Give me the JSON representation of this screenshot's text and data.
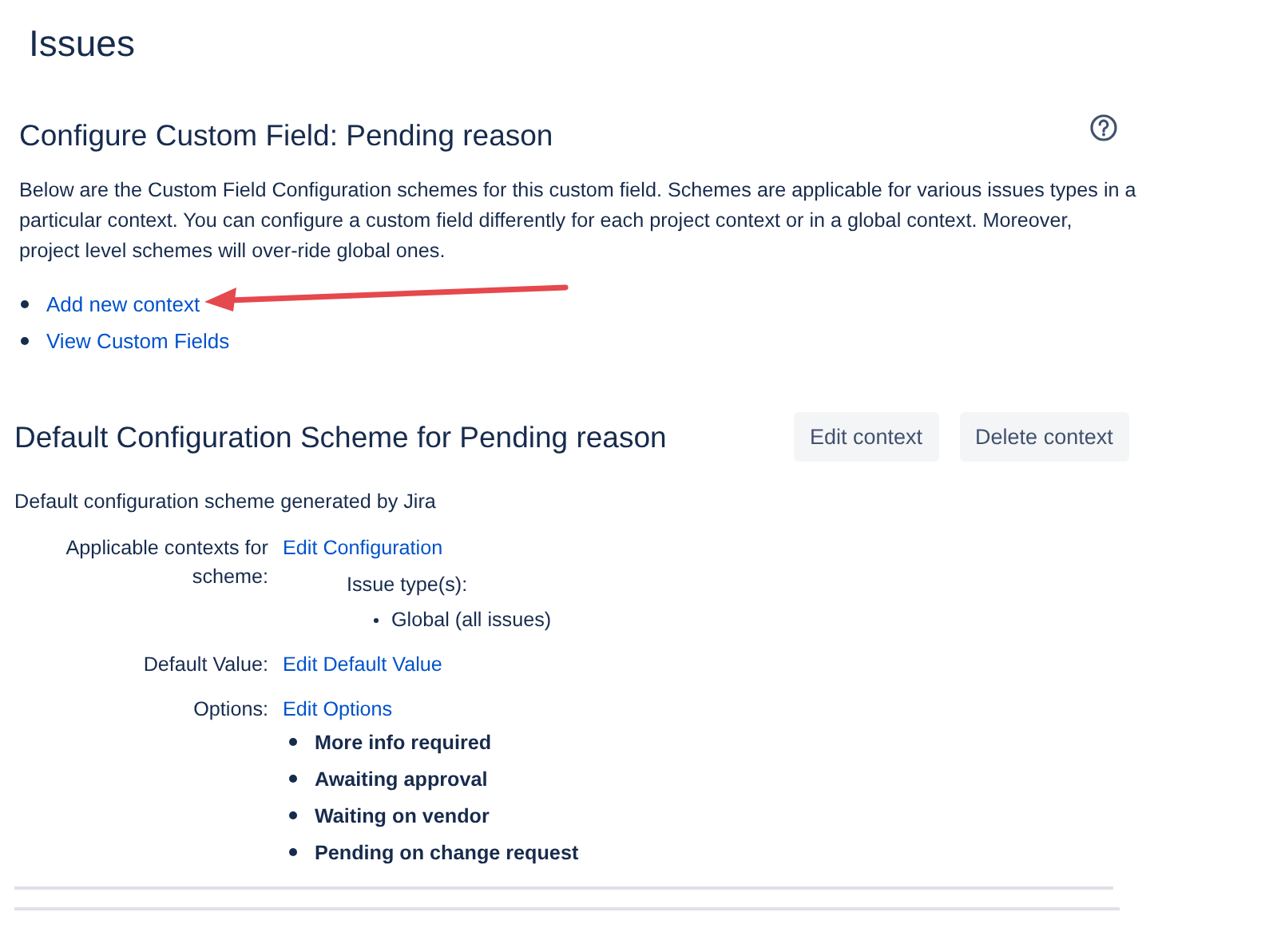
{
  "page_title": "Issues",
  "section": {
    "title": "Configure Custom Field: Pending reason",
    "description": "Below are the Custom Field Configuration schemes for this custom field. Schemes are applicable for various issues types in a particular context. You can configure a custom field differently for each project context or in a global context. Moreover, project level schemes will over-ride global ones.",
    "links": [
      {
        "label": "Add new context"
      },
      {
        "label": "View Custom Fields"
      }
    ]
  },
  "scheme": {
    "title": "Default Configuration Scheme for Pending reason",
    "buttons": [
      "Edit context",
      "Delete context"
    ],
    "description": "Default configuration scheme generated by Jira",
    "rows": [
      {
        "label": "Applicable contexts for scheme:",
        "link": "Edit Configuration",
        "issue_types_label": "Issue type(s):",
        "issue_types": [
          "Global (all issues)"
        ]
      },
      {
        "label": "Default Value:",
        "link": "Edit Default Value"
      },
      {
        "label": "Options:",
        "link": "Edit Options",
        "options": [
          "More info required",
          "Awaiting approval",
          "Waiting on vendor",
          "Pending on change request"
        ]
      }
    ]
  }
}
